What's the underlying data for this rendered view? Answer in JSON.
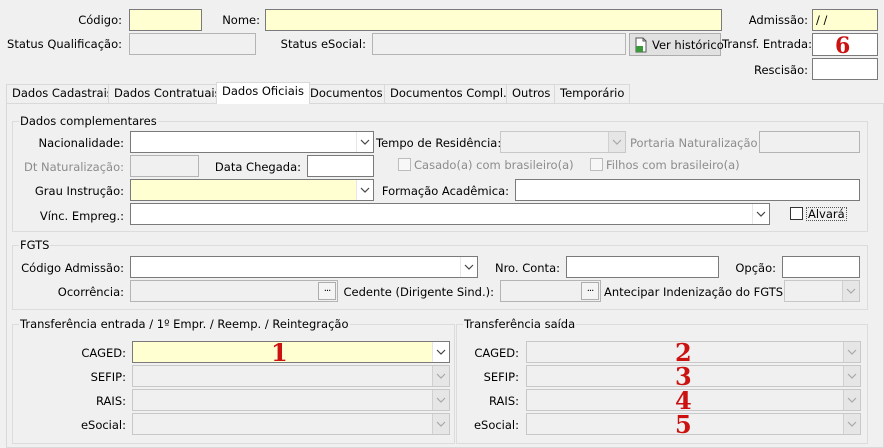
{
  "header": {
    "codigo_label": "Código:",
    "nome_label": "Nome:",
    "admissao_label": "Admissão:",
    "admissao_value": " / /",
    "status_qualificacao_label": "Status Qualificação:",
    "status_esocial_label": "Status eSocial:",
    "ver_historico_label": "Ver histórico",
    "transf_entrada_label": "Transf. Entrada:",
    "transf_entrada_value": "6",
    "rescisao_label": "Rescisão:"
  },
  "tabs": [
    {
      "label": "Dados Cadastrais"
    },
    {
      "label": "Dados Contratuais"
    },
    {
      "label": "Dados Oficiais"
    },
    {
      "label": "Documentos"
    },
    {
      "label": "Documentos Compl."
    },
    {
      "label": "Outros"
    },
    {
      "label": "Temporário"
    }
  ],
  "dados_complementares": {
    "title": "Dados complementares",
    "nacionalidade_label": "Nacionalidade:",
    "tempo_residencia_label": "Tempo de Residência:",
    "portaria_label": "Portaria Naturalização:",
    "dt_naturalizacao_label": "Dt Naturalização:",
    "data_chegada_label": "Data Chegada:",
    "casado_label": "Casado(a) com brasileiro(a)",
    "filhos_label": "Filhos com brasileiro(a)",
    "grau_instrucao_label": "Grau Instrução:",
    "formacao_label": "Formação Acadêmica:",
    "vinc_empreg_label": "Vínc. Empreg.:",
    "alvara_label": "Alvará"
  },
  "fgts": {
    "title": "FGTS",
    "codigo_admissao_label": "Código Admissão:",
    "nro_conta_label": "Nro. Conta:",
    "opcao_label": "Opção:",
    "ocorrencia_label": "Ocorrência:",
    "cedente_label": "Cedente (Dirigente Sind.):",
    "antecipar_label": "Antecipar Indenização do FGTS:"
  },
  "transf_entrada": {
    "title": "Transferência entrada / 1º Empr. / Reemp. / Reintegração",
    "caged_label": "CAGED:",
    "sefip_label": "SEFIP:",
    "rais_label": "RAIS:",
    "esocial_label": "eSocial:",
    "marker": "1"
  },
  "transf_saida": {
    "title": "Transferência saída",
    "caged_label": "CAGED:",
    "sefip_label": "SEFIP:",
    "rais_label": "RAIS:",
    "esocial_label": "eSocial:",
    "markers": [
      "2",
      "3",
      "4",
      "5"
    ]
  },
  "ellipsis": "..."
}
